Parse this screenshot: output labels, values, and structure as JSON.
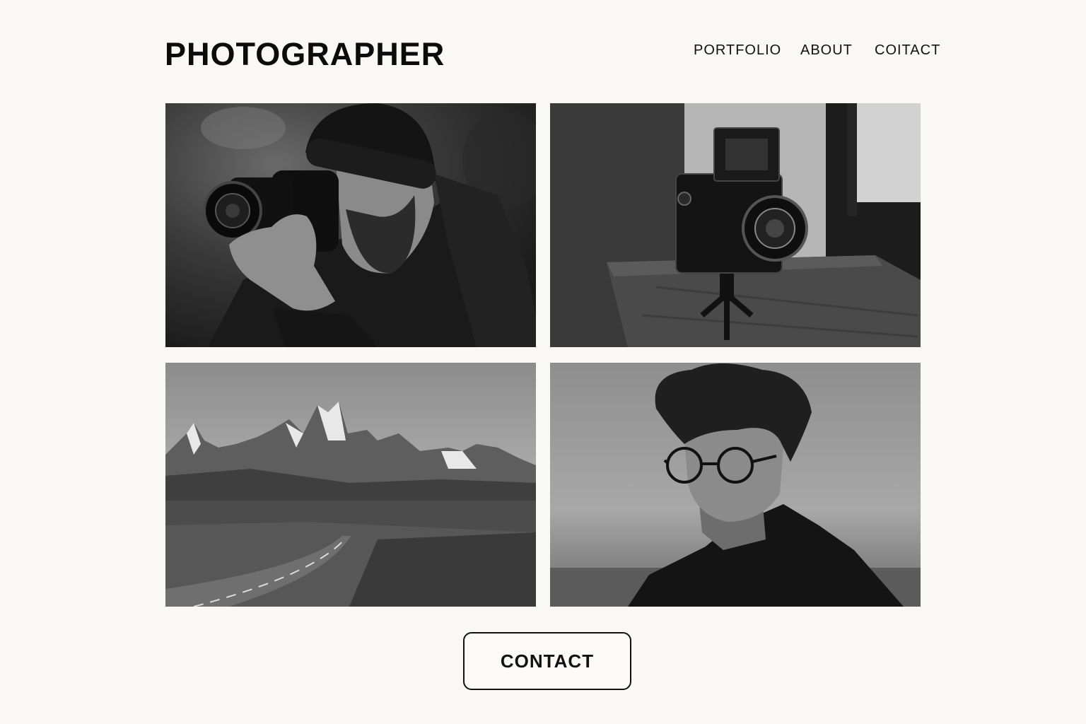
{
  "header": {
    "brand": "PHOTOGRAPHER",
    "nav": [
      {
        "label": "PORTFOLIO"
      },
      {
        "label": "ABOUT"
      },
      {
        "label": "COITACT"
      }
    ]
  },
  "gallery": {
    "photos": [
      {
        "subject": "photographer-with-camera"
      },
      {
        "subject": "vintage-camera-on-windowsill"
      },
      {
        "subject": "mountain-road-landscape"
      },
      {
        "subject": "portrait-with-glasses"
      }
    ]
  },
  "cta": {
    "label": "CONTACT"
  },
  "colors": {
    "background": "#f9f8f4",
    "text": "#111111"
  }
}
